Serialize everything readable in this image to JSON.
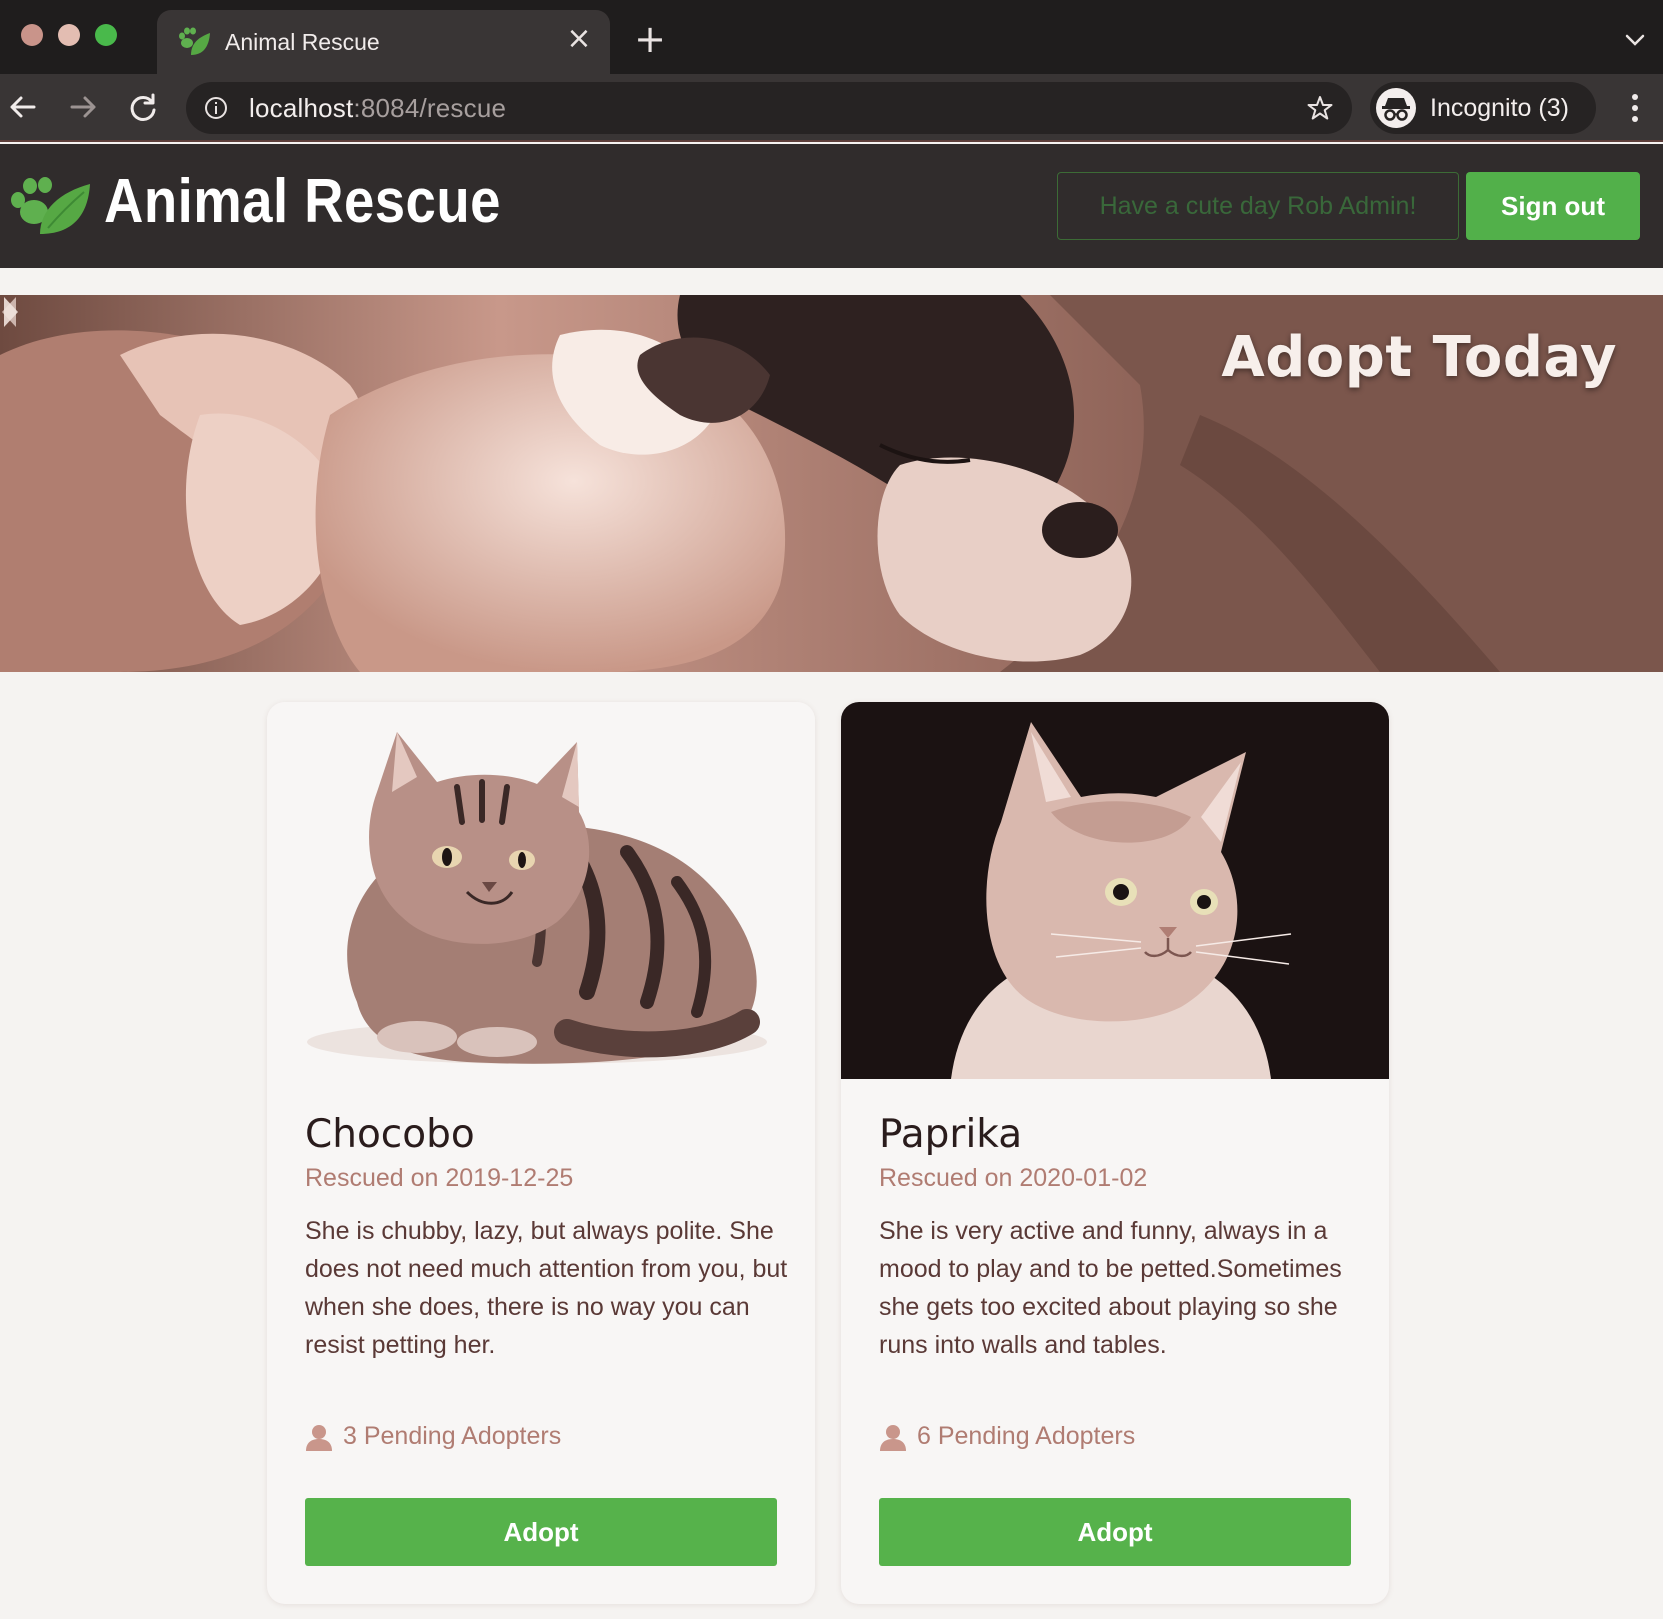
{
  "browser": {
    "tab_title": "Animal Rescue",
    "tab_close": "×",
    "new_tab": "+",
    "url_host": "localhost",
    "url_rest": ":8084/rescue",
    "profile_label": "Incognito (3)"
  },
  "header": {
    "brand": "Animal Rescue",
    "greeting": "Have a cute day Rob Admin!",
    "signout_label": "Sign out",
    "accent_color": "#52b04a"
  },
  "hero": {
    "title": "Adopt Today"
  },
  "animals": [
    {
      "name": "Chocobo",
      "rescued": "Rescued on 2019-12-25",
      "description": "She is chubby, lazy, but always polite. She does not need much attention from you, but when she does, there is no way you can resist petting her.",
      "pending": "3 Pending Adopters",
      "adopt_label": "Adopt"
    },
    {
      "name": "Paprika",
      "rescued": "Rescued on 2020-01-02",
      "description": "She is very active and funny, always in a mood to play and to be petted.Sometimes she gets too excited about playing so she runs into walls and tables.",
      "pending": "6 Pending Adopters",
      "adopt_label": "Adopt"
    }
  ],
  "icons": {
    "back": "arrow-left-icon",
    "forward": "arrow-right-icon",
    "reload": "reload-icon",
    "info": "info-icon",
    "bookmark": "star-icon",
    "profile": "incognito-icon",
    "menu": "kebab-menu-icon",
    "logo": "paw-leaf-icon",
    "pending": "user-icon"
  }
}
